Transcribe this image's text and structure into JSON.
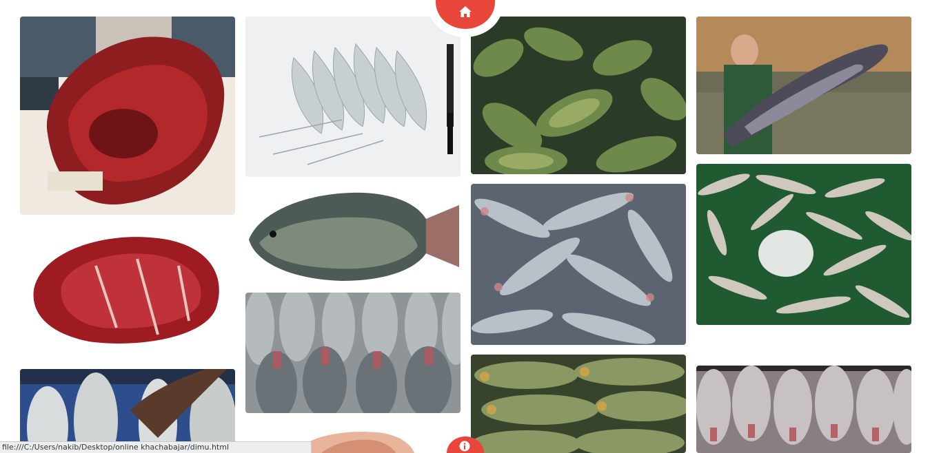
{
  "gallery": {
    "items": [
      {
        "id": "beef-head",
        "icon": "beef-head-photo"
      },
      {
        "id": "prawns",
        "icon": "prawns-photo"
      },
      {
        "id": "koi-fish",
        "icon": "koi-fish-photo"
      },
      {
        "id": "catfish-man",
        "icon": "catfish-photo"
      },
      {
        "id": "beef-steaks",
        "icon": "beef-steak-photo"
      },
      {
        "id": "tilapia",
        "icon": "tilapia-photo"
      },
      {
        "id": "pangas",
        "icon": "pangas-photo"
      },
      {
        "id": "small-fish",
        "icon": "small-fish-photo"
      },
      {
        "id": "hilsa",
        "icon": "hilsa-photo"
      },
      {
        "id": "rohu",
        "icon": "rohu-photo"
      },
      {
        "id": "green-fish",
        "icon": "green-fish-photo"
      },
      {
        "id": "rohu-market",
        "icon": "rohu-market-photo"
      },
      {
        "id": "partial-meat",
        "icon": "meat-photo"
      }
    ]
  },
  "nav": {
    "home_icon": "home-icon",
    "info_icon": "info-icon",
    "accent_color": "#e8463a"
  },
  "status_bar": {
    "text": "file:///C:/Users/nakib/Desktop/online  khachabajar/dimu.html"
  }
}
